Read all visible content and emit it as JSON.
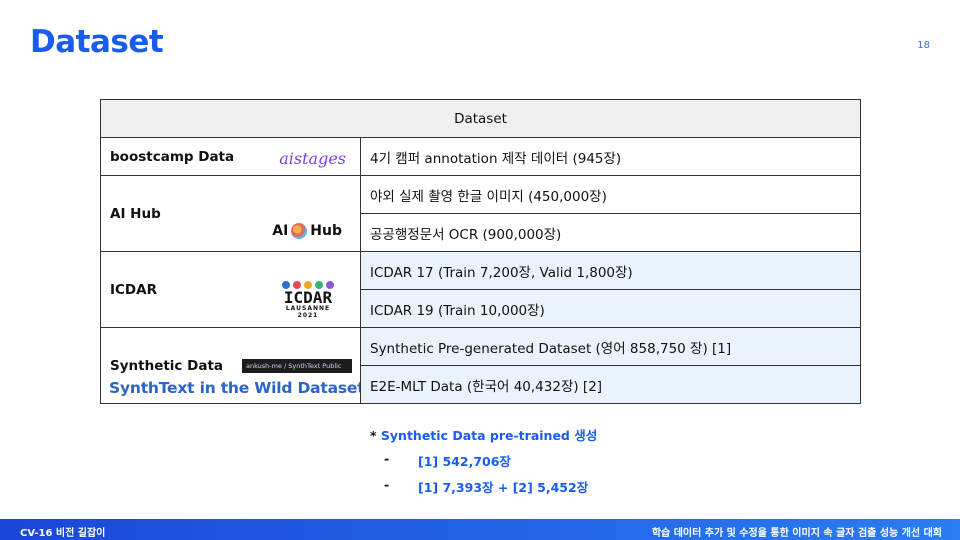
{
  "title": "Dataset",
  "page_number": "18",
  "table": {
    "header": "Dataset",
    "rows": [
      {
        "source": "boostcamp Data",
        "logo_text": "aistages",
        "items": [
          "4기 캠퍼 annotation 제작 데이터 (945장)"
        ]
      },
      {
        "source": "AI Hub",
        "logo_text": "AI Hub",
        "items": [
          "야외 실제 촬영 한글 이미지 (450,000장)",
          "공공행정문서 OCR (900,000장)"
        ]
      },
      {
        "source": "ICDAR",
        "logo_text": "ICDAR",
        "logo_sub": "LAUSANNE 2021",
        "items": [
          "ICDAR 17 (Train 7,200장, Valid 1,800장)",
          "ICDAR 19 (Train 10,000장)"
        ]
      },
      {
        "source": "Synthetic Data",
        "repo_badge": "ankush-me / SynthText  Public",
        "logo_text": "SynthText in the Wild Dataset",
        "items": [
          "Synthetic Pre-generated Dataset (영어 858,750 장) [1]",
          "E2E-MLT Data (한국어 40,432장) [2]"
        ]
      }
    ]
  },
  "notes": {
    "star": "*",
    "head": "Synthetic Data pre-trained 생성",
    "items": [
      {
        "dash": "-",
        "text": "[1] 542,706장"
      },
      {
        "dash": "-",
        "text": "[1] 7,393장 + [2] 5,452장"
      }
    ]
  },
  "footer": {
    "left": "CV-16 비전 길잡이",
    "right": "학습 데이터 추가 및 수정을 통한 이미지 속 글자 검출 성능 개선 대회"
  },
  "colors": {
    "accent": "#1a5cf0",
    "row_highlight": "#eaf3fc",
    "aistages": "#7b3fe0",
    "synthtext": "#2c64c8"
  }
}
